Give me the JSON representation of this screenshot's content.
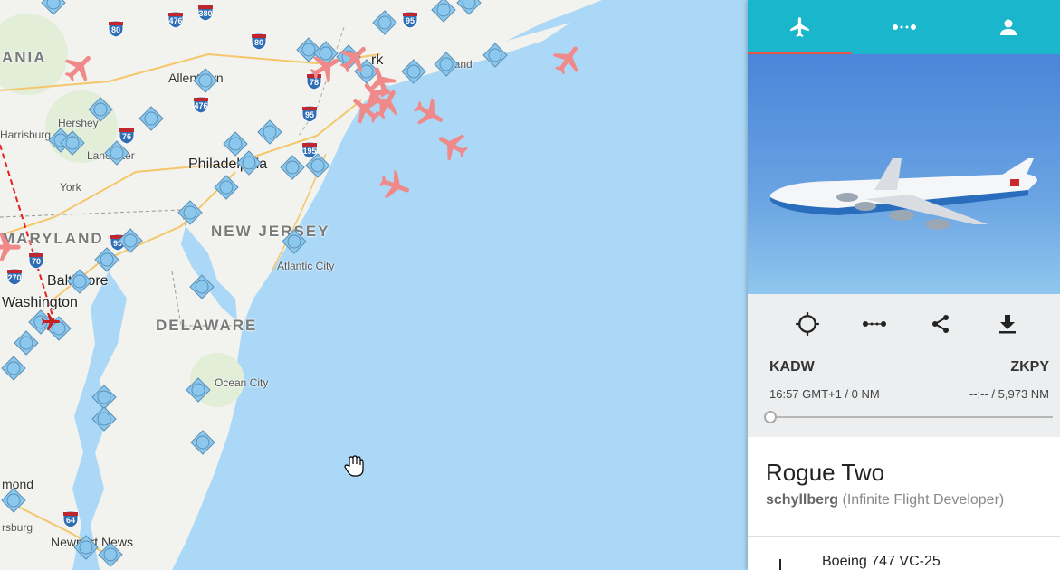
{
  "map": {
    "states": [
      "ANIA",
      "NEW JERSEY",
      "DELAWARE",
      "MARYLAND"
    ],
    "cities": {
      "allentown": "Allentown",
      "philadelphia": "Philadelphia",
      "harrisburg": "Harrisburg",
      "hershey": "Hershey",
      "lancaster": "Lancaster",
      "york": "York",
      "baltimore": "Baltimore",
      "washington": "Washington",
      "atlantic_city": "Atlantic City",
      "ocean_city": "Ocean City",
      "newport_news": "Newport News",
      "newark": "rk",
      "long_island": "gand",
      "richmond": "mond",
      "petersburg": "rsburg"
    },
    "shields": [
      "476",
      "380",
      "80",
      "80",
      "476",
      "95",
      "95",
      "76",
      "195",
      "95",
      "270",
      "70",
      "64",
      "78"
    ]
  },
  "panel": {
    "tabs": [
      {
        "name": "flight",
        "icon": "airplane-icon"
      },
      {
        "name": "route",
        "icon": "route-icon"
      },
      {
        "name": "pilot",
        "icon": "person-icon"
      }
    ],
    "controls": [
      "locate-icon",
      "route-icon",
      "share-icon",
      "download-icon"
    ],
    "origin": {
      "code": "KADW",
      "detail": "16:57 GMT+1 / 0 NM"
    },
    "destination": {
      "code": "ZKPY",
      "detail": "--:-- / 5,973 NM"
    },
    "progress": 0.0,
    "callsign": "Rogue Two",
    "pilot_name": "schyllberg",
    "pilot_role": "(Infinite Flight Developer)",
    "aircraft": "Boeing 747 VC-25"
  },
  "colors": {
    "accent": "#1ab6cc",
    "tab_indicator": "#e5564a",
    "airport": "#8cc8ee",
    "plane": "#f08a8a",
    "ocean": "#abd8f7",
    "land": "#f2f2ee"
  }
}
